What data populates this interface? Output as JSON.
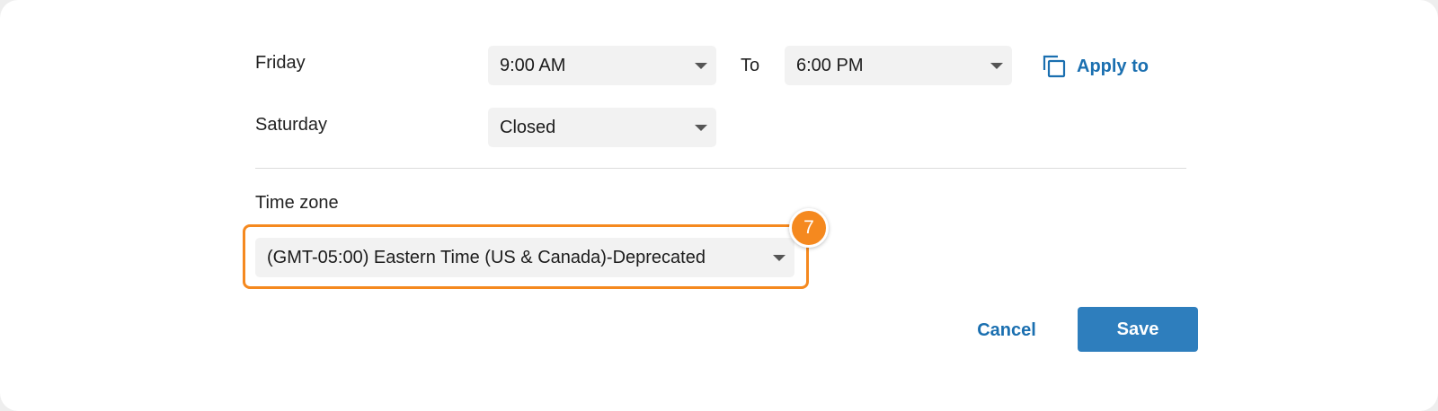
{
  "schedule": {
    "rows": [
      {
        "day": "Friday",
        "open": "9:00 AM",
        "close": "6:00 PM"
      },
      {
        "day": "Saturday",
        "open": "Closed"
      }
    ],
    "to_label": "To",
    "apply_to_label": "Apply to"
  },
  "timezone": {
    "label": "Time zone",
    "value": "(GMT-05:00) Eastern Time (US & Canada)-Deprecated"
  },
  "callout": {
    "step": "7",
    "color": "#f5891f"
  },
  "actions": {
    "cancel_label": "Cancel",
    "save_label": "Save"
  },
  "colors": {
    "link": "#1a6fb0",
    "primary_button": "#2e7ebd",
    "select_background": "#f2f2f2"
  }
}
